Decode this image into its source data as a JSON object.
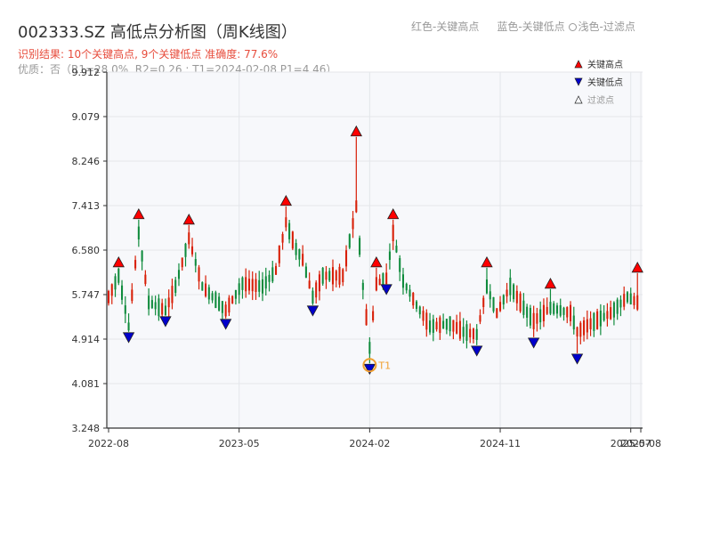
{
  "header": {
    "title": "002333.SZ 高低点分析图（周K线图）",
    "result": "识别结果: 10个关键高点, 9个关键低点   准确度: 77.6%",
    "quality": "优质：否（R1=28.0%, R2=0.26 ; T1=2024-02-08 P1=4.46）"
  },
  "top_legend": {
    "red": "红色-关键高点",
    "blue": "蓝色-关键低点",
    "light": "浅色-过滤点"
  },
  "colors": {
    "up": "#d81e06",
    "down": "#0f8b3c",
    "high_marker": "#ff0000",
    "low_marker": "#0000cc",
    "t1_ring": "#f0a030",
    "plot_bg": "#f7f8fb",
    "grid": "#e4e6ea"
  },
  "chart_data": {
    "type": "candlestick",
    "title": "002333.SZ 高低点分析图（周K线图）",
    "y_ticks": [
      "9.912",
      "9.079",
      "8.246",
      "7.413",
      "6.580",
      "5.747",
      "4.914",
      "4.081",
      "3.248"
    ],
    "ylim": [
      3.248,
      9.912
    ],
    "x_ticks": [
      {
        "label": "2022-08",
        "i": 0
      },
      {
        "label": "2023-05",
        "i": 39
      },
      {
        "label": "2024-02",
        "i": 78
      },
      {
        "label": "2024-11",
        "i": 117
      },
      {
        "label": "2025-07",
        "i": 156
      },
      {
        "label": "2025-08",
        "i": 159
      }
    ],
    "bar_count": 159,
    "legend": {
      "high": "关键高点",
      "low": "关键低点",
      "filtered": "过滤点"
    },
    "key_highs": [
      {
        "i": 3,
        "value": 6.25
      },
      {
        "i": 9,
        "value": 7.15
      },
      {
        "i": 24,
        "value": 7.05
      },
      {
        "i": 53,
        "value": 7.4
      },
      {
        "i": 74,
        "value": 8.7
      },
      {
        "i": 80,
        "value": 6.25
      },
      {
        "i": 85,
        "value": 7.15
      },
      {
        "i": 113,
        "value": 6.25
      },
      {
        "i": 132,
        "value": 5.85
      },
      {
        "i": 158,
        "value": 6.15
      }
    ],
    "key_lows": [
      {
        "i": 6,
        "value": 5.05
      },
      {
        "i": 17,
        "value": 5.35
      },
      {
        "i": 35,
        "value": 5.3
      },
      {
        "i": 61,
        "value": 5.55
      },
      {
        "i": 78,
        "value": 4.46
      },
      {
        "i": 83,
        "value": 5.95
      },
      {
        "i": 110,
        "value": 4.8
      },
      {
        "i": 127,
        "value": 4.95
      },
      {
        "i": 140,
        "value": 4.65
      }
    ],
    "t1": {
      "label": "T1",
      "i": 78,
      "value": 4.46
    }
  }
}
